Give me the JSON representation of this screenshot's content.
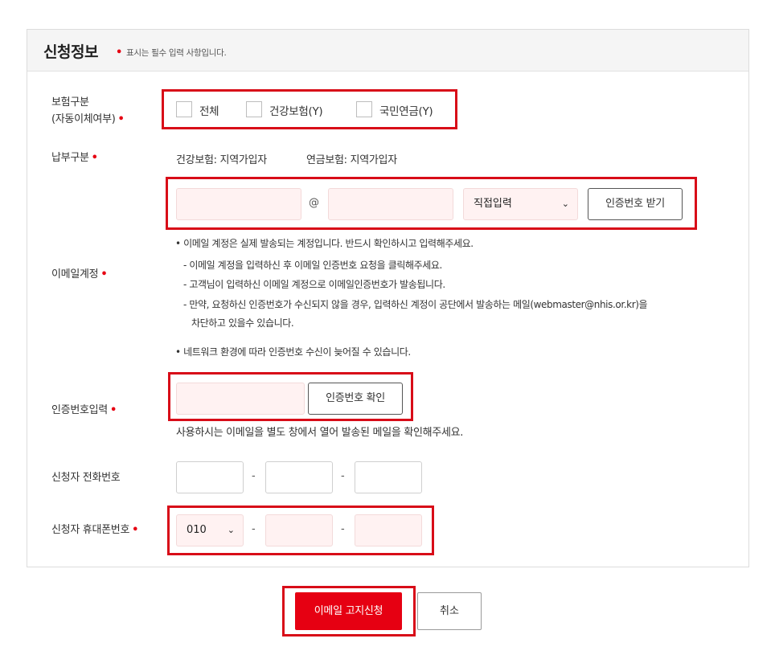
{
  "section": {
    "title": "신청정보",
    "required_dot": "•",
    "required_note": "표시는 필수 입력 사항입니다."
  },
  "insurance_type": {
    "label_line1": "보험구분",
    "label_line2": "(자동이체여부)",
    "required_mark": "•",
    "options": [
      "전체",
      "건강보험(Y)",
      "국민연금(Y)"
    ]
  },
  "payment_type": {
    "label": "납부구분",
    "required_mark": "•",
    "health": "건강보험: 지역가입자",
    "pension": "연금보험: 지역가입자"
  },
  "email": {
    "label": "이메일계정",
    "required_mark": "•",
    "local_value": "",
    "at": "@",
    "domain_value": "",
    "domain_select": "직접입력",
    "request_code_button": "인증번호 받기",
    "guide": {
      "line1": "• 이메일 계정은 실제 발송되는 계정입니다. 반드시 확인하시고 입력해주세요.",
      "line2": "- 이메일 계정을 입력하신 후 이메일 인증번호 요청을 클릭해주세요.",
      "line3": "- 고객님이 입력하신 이메일 계정으로 이메일인증번호가 발송됩니다.",
      "line4": "- 만약, 요청하신 인증번호가 수신되지 않을 경우, 입력하신 계정이 공단에서 발송하는 메일(webmaster@nhis.or.kr)을",
      "line5": "차단하고 있을수 있습니다.",
      "line6": "• 네트워크 환경에 따라 인증번호 수신이 늦어질 수 있습니다."
    }
  },
  "auth_code": {
    "label": "인증번호입력",
    "required_mark": "•",
    "value": "",
    "confirm_button": "인증번호 확인",
    "help": "사용하시는 이메일을 별도 창에서 열어 발송된 메일을 확인해주세요."
  },
  "phone": {
    "label": "신청자 전화번호",
    "part1": "",
    "part2": "",
    "part3": "",
    "dash": "-"
  },
  "mobile": {
    "label": "신청자 휴대폰번호",
    "required_mark": "•",
    "prefix": "010",
    "part2": "",
    "part3": "",
    "dash": "-"
  },
  "actions": {
    "submit": "이메일 고지신청",
    "cancel": "취소"
  },
  "colors": {
    "accent_red": "#e60012",
    "highlight_box": "#d80c18",
    "input_pink": "#fff2f2"
  }
}
